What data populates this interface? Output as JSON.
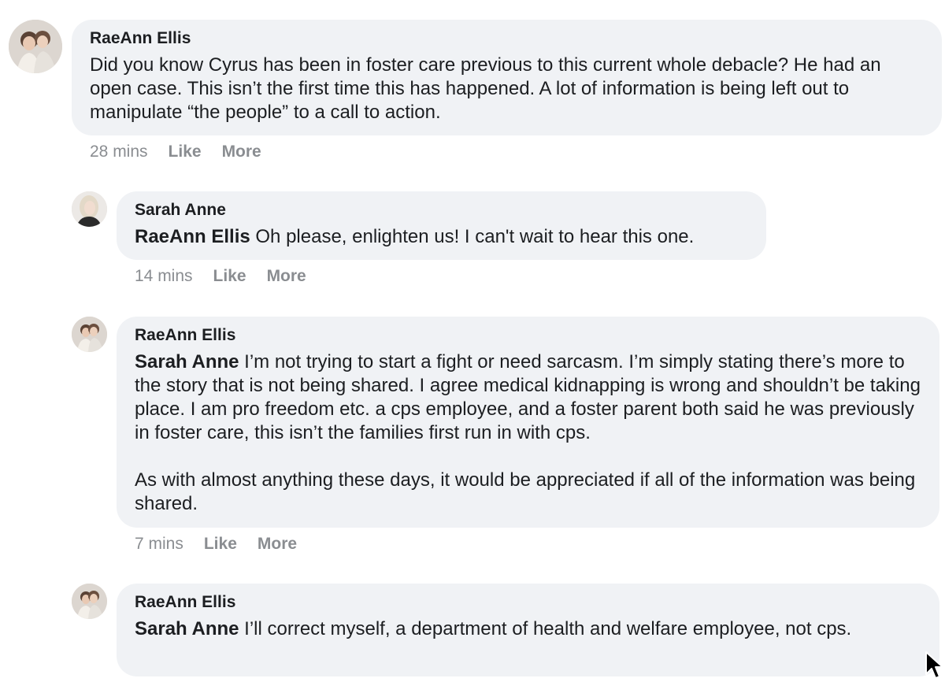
{
  "comments": [
    {
      "author": "RaeAnn Ellis",
      "mention": "",
      "paragraphs": [
        "Did you know Cyrus has been in foster care previous to this current whole debacle? He had an open case. This isn’t the first time this has happened. A lot of information is being left out to manipulate “the people” to a call to action."
      ],
      "time": "28 mins",
      "like_label": "Like",
      "more_label": "More"
    },
    {
      "author": "Sarah Anne",
      "mention": "RaeAnn Ellis",
      "paragraphs": [
        "Oh please, enlighten us! I can't wait to hear this one."
      ],
      "time": "14 mins",
      "like_label": "Like",
      "more_label": "More"
    },
    {
      "author": "RaeAnn Ellis",
      "mention": "Sarah Anne",
      "paragraphs": [
        "I’m not trying to start a fight or need sarcasm. I’m simply stating there’s more to the story that is not being shared. I agree medical kidnapping is wrong and shouldn’t be taking place. I am pro freedom etc. a cps employee, and a foster parent both said he was previously in foster care, this isn’t the families first run in with cps.",
        "As with almost anything these days, it would be appreciated if all of the information was being shared."
      ],
      "time": "7 mins",
      "like_label": "Like",
      "more_label": "More"
    },
    {
      "author": "RaeAnn Ellis",
      "mention": "Sarah Anne",
      "paragraphs": [
        "I’ll correct myself, a department of health and welfare employee, not cps."
      ],
      "time": "",
      "like_label": "",
      "more_label": ""
    }
  ],
  "icons": {
    "avatar_raeann": "profile-photo-couple",
    "avatar_sarah": "profile-photo-woman",
    "cursor": "mouse-pointer-arrow"
  }
}
